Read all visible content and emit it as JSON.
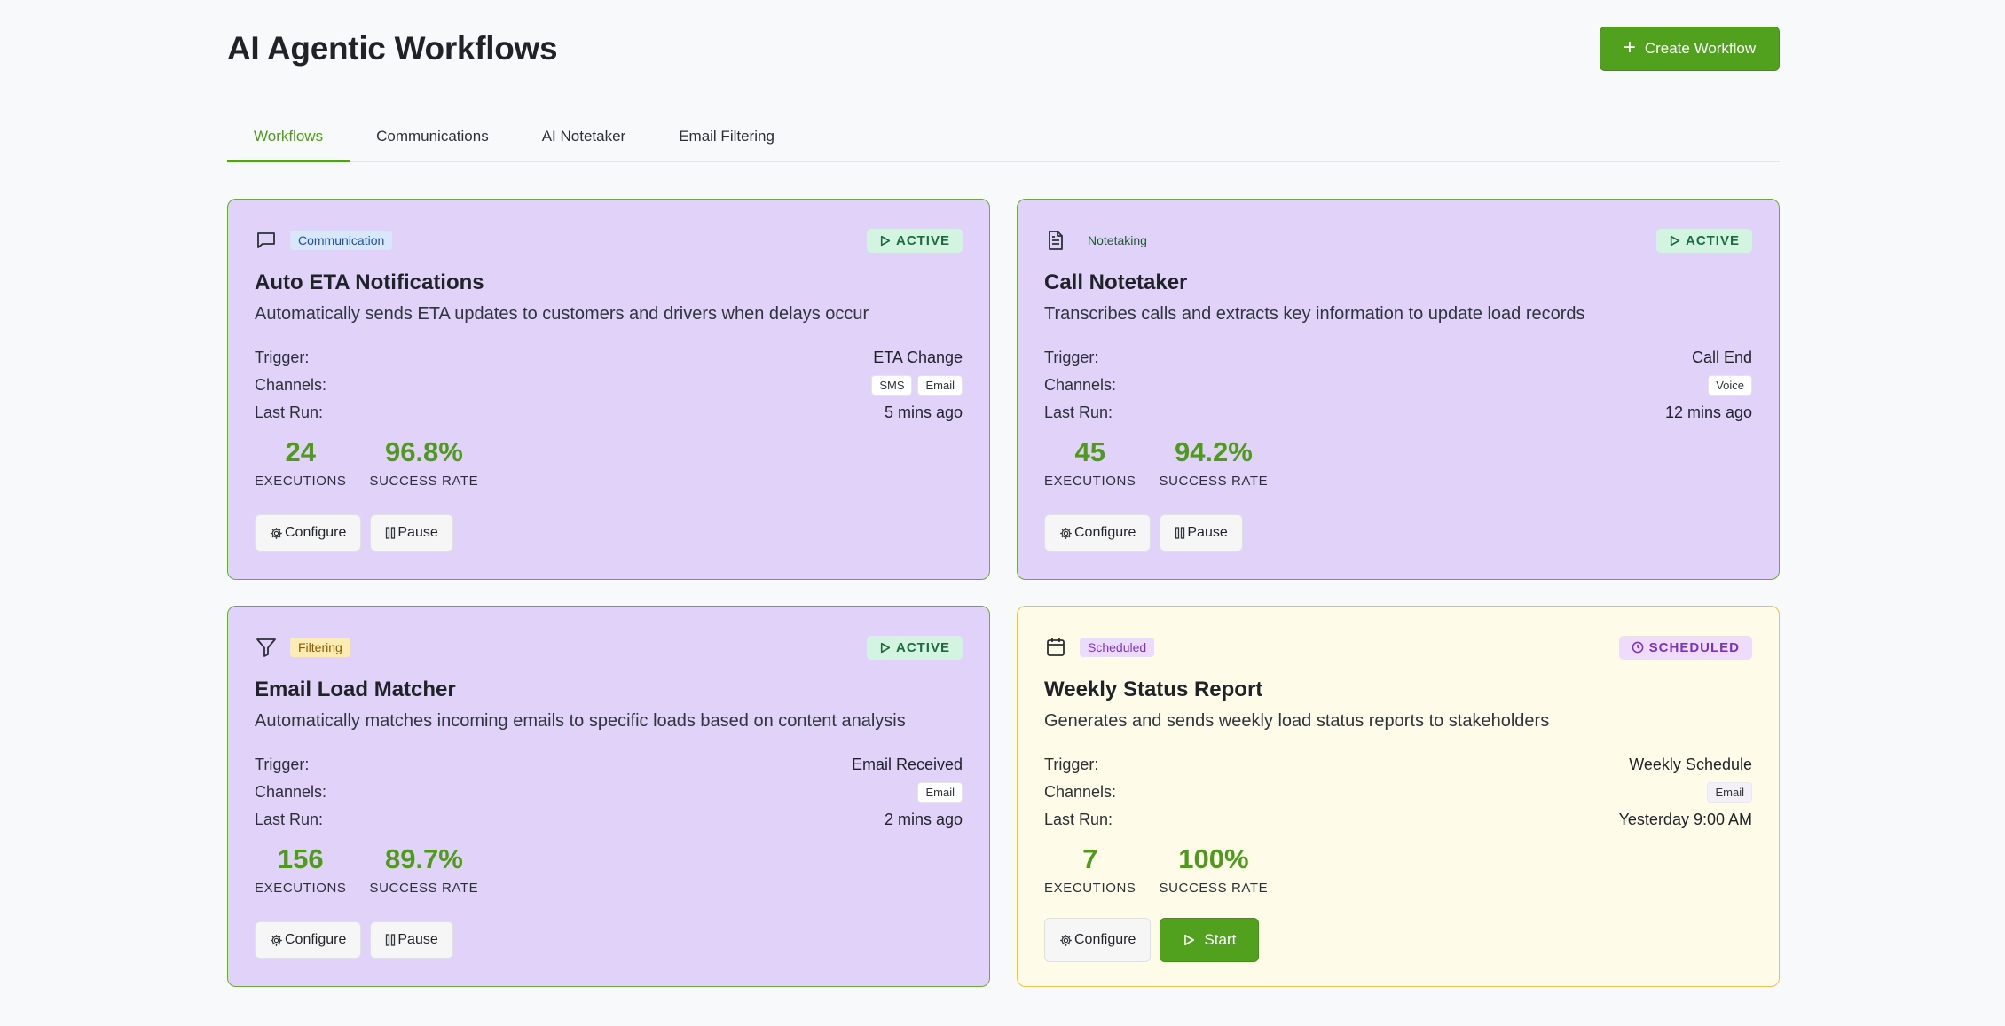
{
  "header": {
    "title": "AI Agentic Workflows",
    "create_button": "Create Workflow"
  },
  "tabs": [
    {
      "label": "Workflows",
      "active": true
    },
    {
      "label": "Communications",
      "active": false
    },
    {
      "label": "AI Notetaker",
      "active": false
    },
    {
      "label": "Email Filtering",
      "active": false
    }
  ],
  "labels": {
    "trigger": "Trigger:",
    "channels": "Channels:",
    "last_run": "Last Run:",
    "executions": "EXECUTIONS",
    "success_rate": "SUCCESS RATE",
    "configure": "Configure",
    "pause": "Pause",
    "start": "Start"
  },
  "workflows": [
    {
      "icon": "message-icon",
      "category": "Communication",
      "status": "ACTIVE",
      "title": "Auto ETA Notifications",
      "description": "Automatically sends ETA updates to customers and drivers when delays occur",
      "trigger": "ETA Change",
      "channels": [
        "SMS",
        "Email"
      ],
      "last_run": "5 mins ago",
      "executions": "24",
      "success_rate": "96.8%",
      "secondary_action": "Pause"
    },
    {
      "icon": "document-icon",
      "category": "Notetaking",
      "status": "ACTIVE",
      "title": "Call Notetaker",
      "description": "Transcribes calls and extracts key information to update load records",
      "trigger": "Call End",
      "channels": [
        "Voice"
      ],
      "last_run": "12 mins ago",
      "executions": "45",
      "success_rate": "94.2%",
      "secondary_action": "Pause"
    },
    {
      "icon": "filter-icon",
      "category": "Filtering",
      "status": "ACTIVE",
      "title": "Email Load Matcher",
      "description": "Automatically matches incoming emails to specific loads based on content analysis",
      "trigger": "Email Received",
      "channels": [
        "Email"
      ],
      "last_run": "2 mins ago",
      "executions": "156",
      "success_rate": "89.7%",
      "secondary_action": "Pause"
    },
    {
      "icon": "calendar-icon",
      "category": "Scheduled",
      "status": "SCHEDULED",
      "title": "Weekly Status Report",
      "description": "Generates and sends weekly load status reports to stakeholders",
      "trigger": "Weekly Schedule",
      "channels": [
        "Email"
      ],
      "last_run": "Yesterday 9:00 AM",
      "executions": "7",
      "success_rate": "100%",
      "secondary_action": "Start"
    }
  ],
  "colors": {
    "accent": "#52a11e",
    "card_active_bg": "#e1d2fa",
    "card_scheduled_bg": "#fefbe8",
    "status_active_bg": "#d4f4e2",
    "status_scheduled_bg": "#efdcfb"
  }
}
